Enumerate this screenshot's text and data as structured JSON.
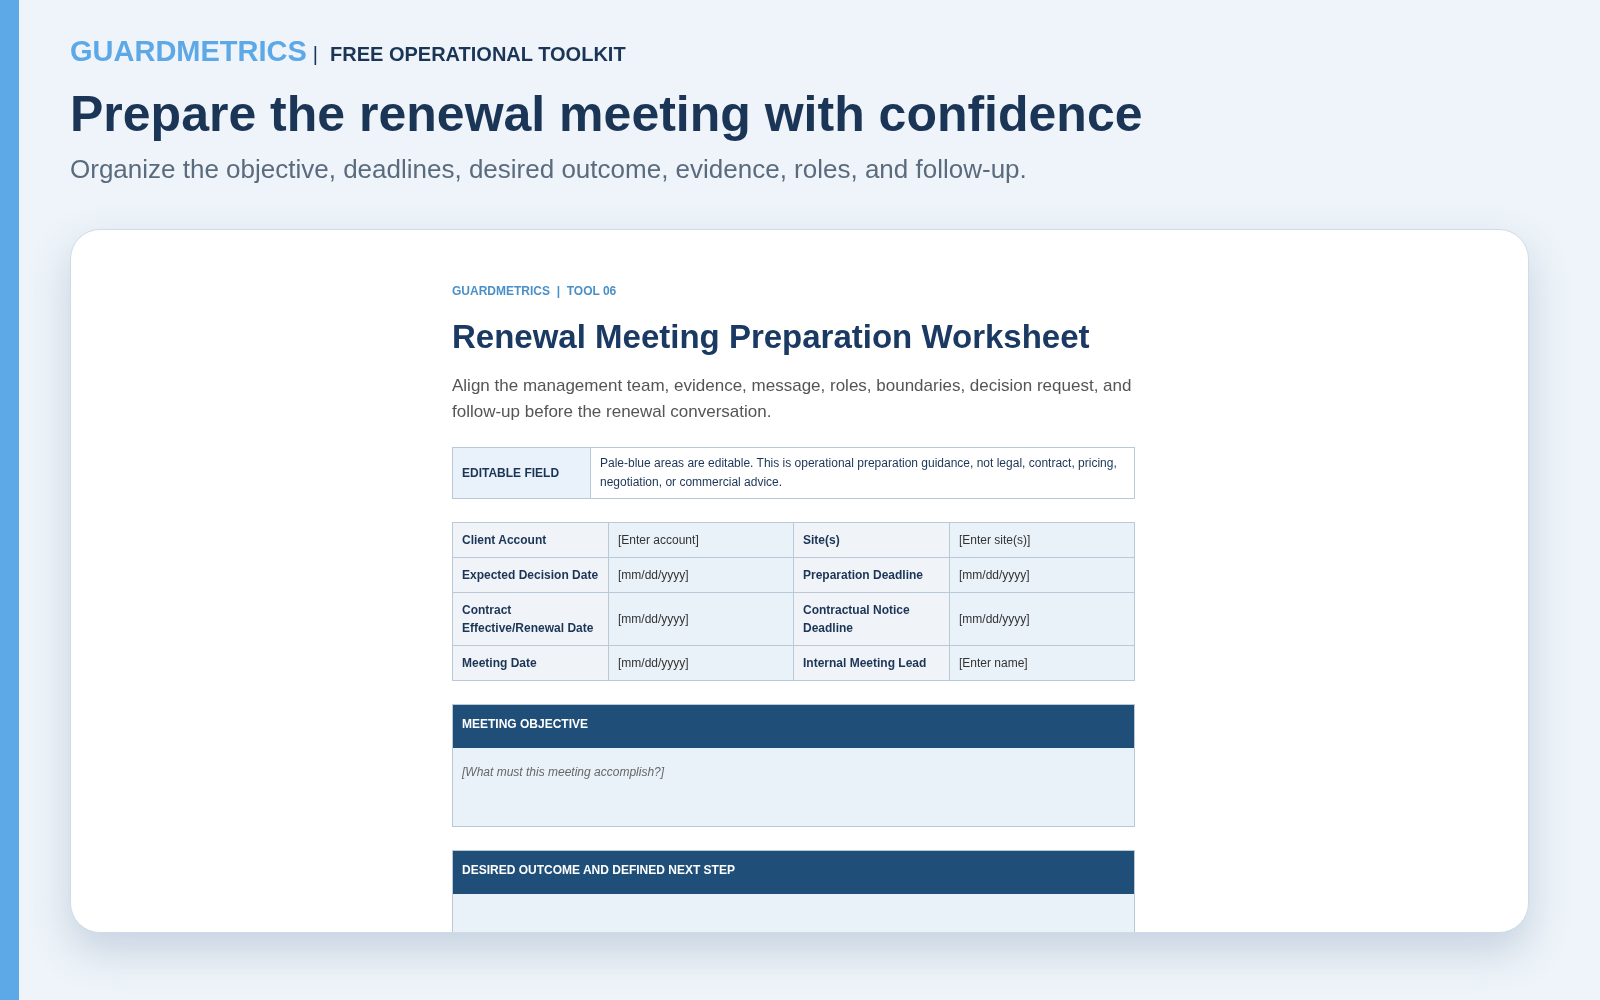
{
  "header": {
    "brand": "GUARDMETRICS",
    "separator": "|",
    "tagline": "FREE OPERATIONAL TOOLKIT",
    "title": "Prepare the renewal meeting with confidence",
    "subtitle": "Organize the objective, deadlines, desired outcome, evidence, roles, and follow-up."
  },
  "document": {
    "kicker": "GUARDMETRICS  |  TOOL 06",
    "title": "Renewal Meeting Preparation Worksheet",
    "intro": "Align the management team, evidence, message, roles, boundaries, decision request, and follow-up before the renewal conversation.",
    "notice": {
      "label": "EDITABLE FIELD",
      "text": "Pale-blue areas are editable. This is operational preparation guidance, not legal, contract, pricing, negotiation, or commercial advice."
    },
    "fields": [
      [
        {
          "label": "Client Account",
          "value": "[Enter account]"
        },
        {
          "label": "Site(s)",
          "value": "[Enter site(s)]"
        }
      ],
      [
        {
          "label": "Expected Decision Date",
          "value": "[mm/dd/yyyy]"
        },
        {
          "label": "Preparation Deadline",
          "value": "[mm/dd/yyyy]"
        }
      ],
      [
        {
          "label": "Contract Effective/Renewal Date",
          "value": "[mm/dd/yyyy]"
        },
        {
          "label": "Contractual Notice Deadline",
          "value": "[mm/dd/yyyy]"
        }
      ],
      [
        {
          "label": "Meeting Date",
          "value": "[mm/dd/yyyy]"
        },
        {
          "label": "Internal Meeting Lead",
          "value": "[Enter name]"
        }
      ]
    ],
    "sections": [
      {
        "title": "MEETING OBJECTIVE",
        "placeholder": "[What must this meeting accomplish?]"
      },
      {
        "title": "DESIRED OUTCOME AND DEFINED NEXT STEP"
      }
    ]
  }
}
